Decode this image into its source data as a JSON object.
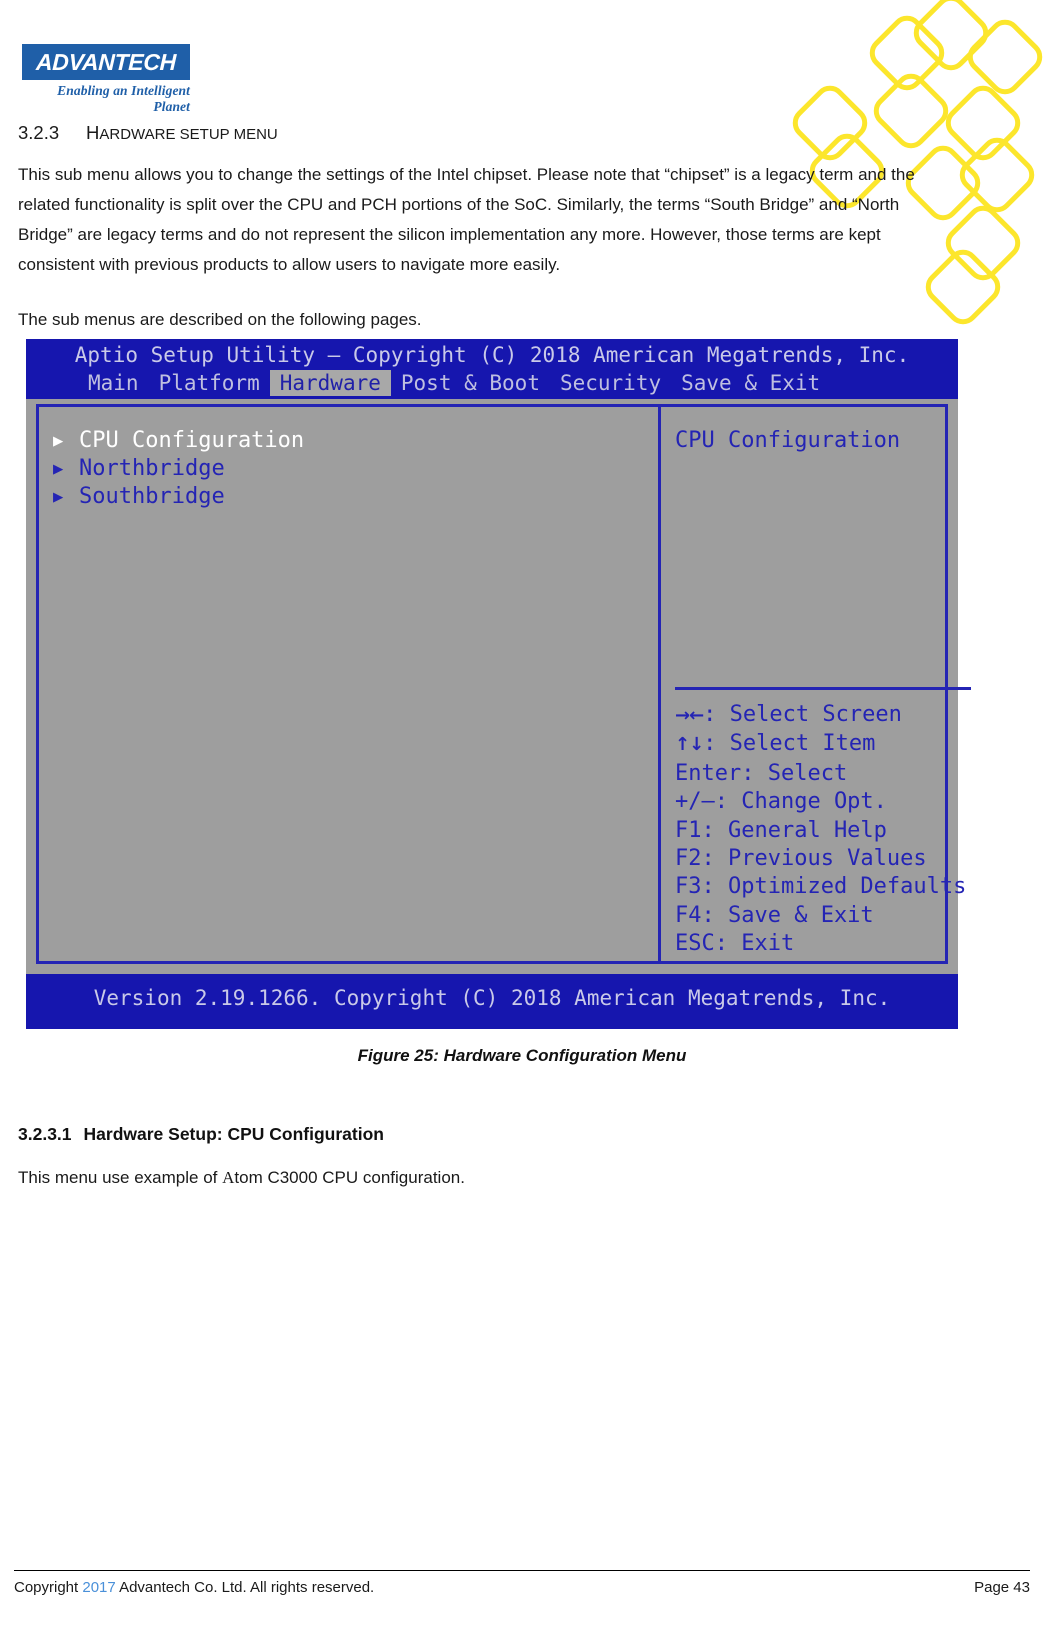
{
  "brand": {
    "logo_text": "ADVANTECH",
    "tagline": "Enabling an Intelligent Planet"
  },
  "section": {
    "number": "3.2.3",
    "title_first": "H",
    "title_rest_1": "ARDWARE",
    "title_rest_2": "SETUP MENU",
    "paragraph_1": "This sub menu allows you to change the settings of the Intel chipset. Please note that “chipset” is a legacy term and the related functionality is split over the CPU and PCH portions of the SoC. Similarly, the terms “South Bridge” and “North Bridge” are legacy terms and do not represent the silicon implementation any more. However, those terms are kept consistent with previous products to allow users to navigate more easily.",
    "paragraph_2": "The sub menus are described on the following pages."
  },
  "bios": {
    "title": "Aptio Setup Utility – Copyright (C) 2018 American Megatrends, Inc.",
    "tabs": [
      {
        "label": "Main",
        "active": false
      },
      {
        "label": "Platform",
        "active": false
      },
      {
        "label": "Hardware",
        "active": true
      },
      {
        "label": "Post & Boot",
        "active": false
      },
      {
        "label": "Security",
        "active": false
      },
      {
        "label": "Save & Exit",
        "active": false
      }
    ],
    "menu_items": [
      {
        "label": "CPU Configuration",
        "selected": true
      },
      {
        "label": "Northbridge",
        "selected": false
      },
      {
        "label": "Southbridge",
        "selected": false
      }
    ],
    "help_title": "CPU Configuration",
    "help_keys": [
      {
        "glyph": "→←",
        "text": ": Select Screen"
      },
      {
        "glyph": "↑↓",
        "text": ": Select Item"
      },
      {
        "glyph": "",
        "text": "Enter: Select"
      },
      {
        "glyph": "",
        "text": "+/–: Change Opt."
      },
      {
        "glyph": "",
        "text": "F1: General Help"
      },
      {
        "glyph": "",
        "text": "F2: Previous Values"
      },
      {
        "glyph": "",
        "text": "F3: Optimized Defaults"
      },
      {
        "glyph": "",
        "text": "F4: Save & Exit"
      },
      {
        "glyph": "",
        "text": "ESC: Exit"
      }
    ],
    "version": "Version 2.19.1266. Copyright (C) 2018 American Megatrends, Inc.",
    "colors": {
      "header_blue": "#1616AE",
      "body_gray": "#9E9E9E",
      "text_blue": "#2424B4",
      "tab_active_bg": "#A8A8A8"
    }
  },
  "figure": {
    "caption": "Figure 25: Hardware Configuration Menu"
  },
  "subsection": {
    "number": "3.2.3.1",
    "title": "Hardware Setup: CPU Configuration",
    "body_pre": "This menu use example of ",
    "body_a": "A",
    "body_post": "tom C3000 CPU configuration."
  },
  "footer": {
    "copyright_pre": "Copyright ",
    "year": "2017",
    "copyright_post": " Advantech Co. Ltd. All rights reserved.",
    "page": "Page 43"
  },
  "decoration": {
    "color": "#FCE62C",
    "shape": "rounded-square-outline"
  }
}
